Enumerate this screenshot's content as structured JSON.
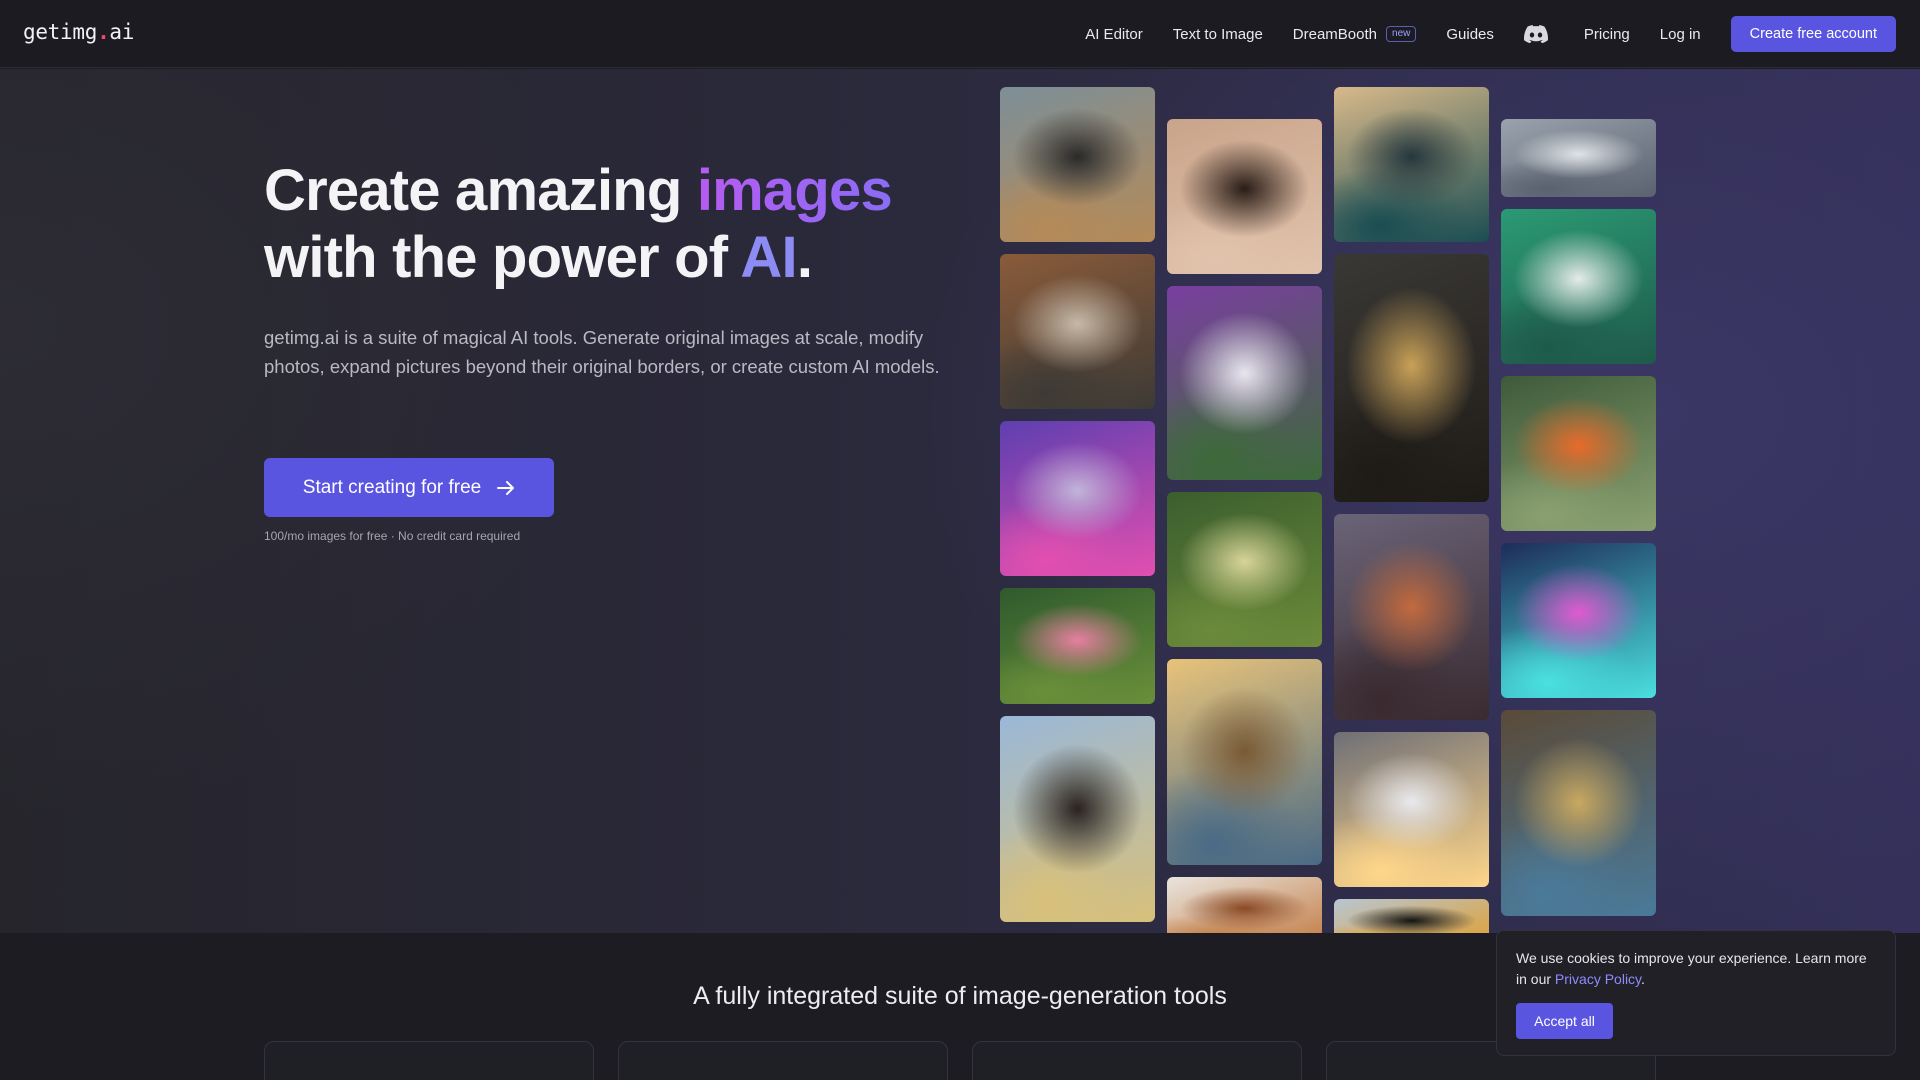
{
  "brand": {
    "name": "getimg",
    "dot": ".",
    "suffix": "ai"
  },
  "nav": {
    "links": [
      {
        "label": "AI Editor"
      },
      {
        "label": "Text to Image"
      },
      {
        "label": "DreamBooth",
        "badge": "new"
      },
      {
        "label": "Guides"
      }
    ],
    "discord_icon": "discord-icon",
    "pricing": "Pricing",
    "login": "Log in",
    "cta": "Create free account"
  },
  "hero": {
    "title_part1": "Create amazing ",
    "title_highlight": "images",
    "title_part2": "with the power of ",
    "title_ai": "AI",
    "title_end": ".",
    "lead": "getimg.ai is a suite of magical AI tools. Generate original images at scale, modify photos, expand pictures beyond their original borders, or create custom AI models.",
    "cta": "Start creating for free",
    "cta_icon": "arrow-right-icon",
    "fineprint": "100/mo images for free · No credit card required"
  },
  "gallery": {
    "tiles": [
      {
        "name": "portrait-man-coat",
        "colors": [
          "#7d8f98",
          "#2b2a2a",
          "#b48a58"
        ]
      },
      {
        "name": "bedroom-window",
        "colors": [
          "#8a5b3a",
          "#c6b9a8",
          "#3d3a35"
        ]
      },
      {
        "name": "fantasy-cat",
        "colors": [
          "#5d3fb0",
          "#c0b4d8",
          "#e24fb0"
        ]
      },
      {
        "name": "pink-roses",
        "colors": [
          "#2f5a2d",
          "#e67fa0",
          "#6a8f3a"
        ]
      },
      {
        "name": "horse-rider",
        "colors": [
          "#9ab8d8",
          "#2a2320",
          "#d8c07a"
        ]
      },
      {
        "name": "curly-hair-man",
        "colors": [
          "#c9a48a",
          "#2a1d17",
          "#e1c3ad"
        ]
      },
      {
        "name": "flower-goddess",
        "colors": [
          "#7a3fa0",
          "#e9e6ef",
          "#3d6a3a"
        ]
      },
      {
        "name": "sunlit-tree",
        "colors": [
          "#3b5e2e",
          "#d8d498",
          "#6b8a3a"
        ]
      },
      {
        "name": "pyramid",
        "colors": [
          "#e8c37a",
          "#7a5a35",
          "#4a6a85"
        ]
      },
      {
        "name": "wooden-arches",
        "colors": [
          "#e9e5de",
          "#8a4a25",
          "#c27a42"
        ]
      },
      {
        "name": "stormy-sea",
        "colors": [
          "#d8b98a",
          "#26373e",
          "#1a4d52"
        ]
      },
      {
        "name": "golden-skull",
        "colors": [
          "#3a3835",
          "#c9a158",
          "#1e1b17"
        ]
      },
      {
        "name": "forest-mushrooms",
        "colors": [
          "#6a6478",
          "#c26a3e",
          "#3a2a30"
        ]
      },
      {
        "name": "glowing-sneaker",
        "colors": [
          "#6f6f76",
          "#e9e9ee",
          "#ffd68a"
        ]
      },
      {
        "name": "toucan-bird",
        "colors": [
          "#b8c6d2",
          "#141414",
          "#e0a030"
        ]
      },
      {
        "name": "clouds",
        "colors": [
          "#9aa3ad",
          "#dfe3e6",
          "#5a6270"
        ]
      },
      {
        "name": "green-hair-anime",
        "colors": [
          "#2b9a74",
          "#e4ebe8",
          "#1e5a4a"
        ]
      },
      {
        "name": "koi-pond",
        "colors": [
          "#3e5a3a",
          "#e86a2a",
          "#8aa070"
        ]
      },
      {
        "name": "neon-hamster",
        "colors": [
          "#1d2c5a",
          "#e05ad0",
          "#4ae0e0"
        ]
      },
      {
        "name": "masked-warrior",
        "colors": [
          "#5a4a38",
          "#c9a860",
          "#4a7a9a"
        ]
      }
    ]
  },
  "section2": {
    "title": "A fully integrated suite of image-generation tools"
  },
  "cookie": {
    "text": "We use cookies to improve your experience. Learn more in our ",
    "link": "Privacy Policy",
    "end": ".",
    "accept": "Accept all"
  }
}
